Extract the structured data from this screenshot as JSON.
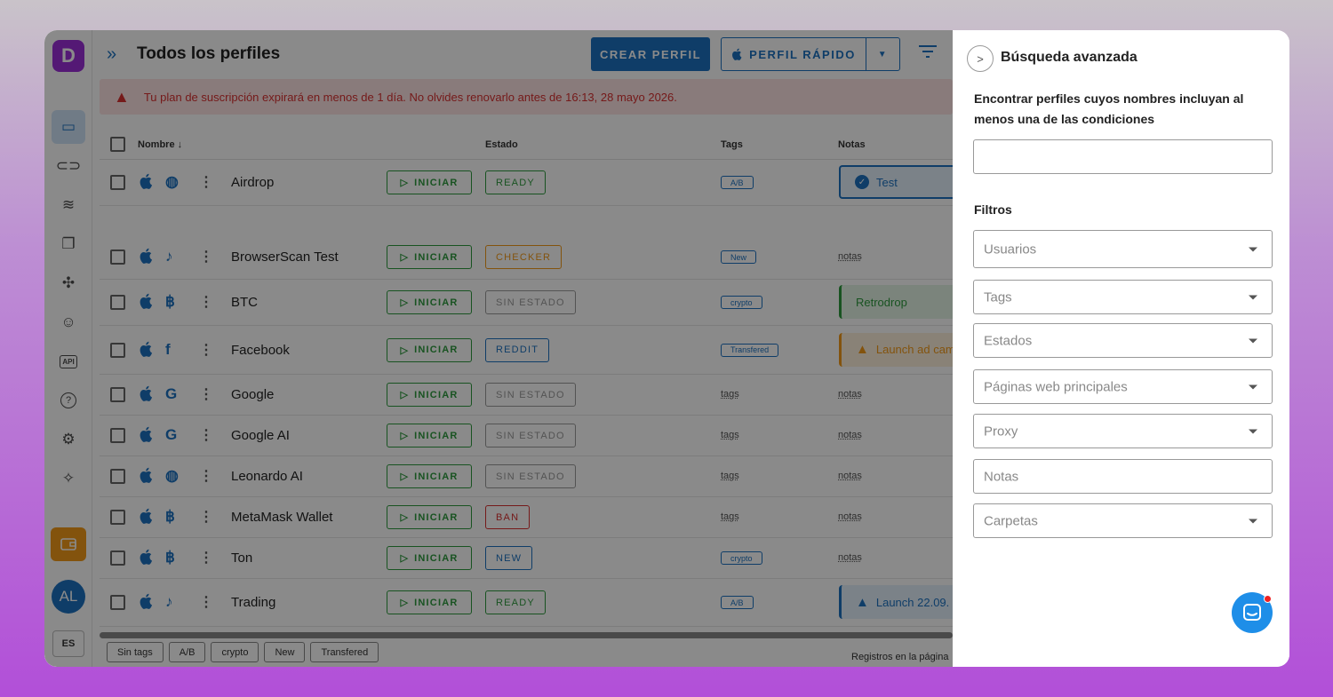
{
  "sidebar": {
    "logo": "D",
    "avatar": "AL",
    "lang": "ES",
    "icons": [
      "browser-icon",
      "link-icon",
      "automation-icon",
      "copy-icon",
      "extension-icon",
      "users-icon",
      "api-icon",
      "help-icon",
      "settings-icon",
      "bulb-icon"
    ],
    "api_label": "API"
  },
  "header": {
    "title": "Todos los perfiles",
    "create_button": "CREAR PERFIL",
    "quick_button": "PERFIL RÁPIDO"
  },
  "alert": {
    "text": "Tu plan de suscripción expirará en menos de 1 día. No olvides renovarlo antes de 16:13, 28 mayo 2026."
  },
  "table": {
    "columns": {
      "name": "Nombre",
      "status": "Estado",
      "tags": "Tags",
      "notes": "Notas"
    },
    "start_label": "INICIAR",
    "placeholder_tags": "tags",
    "placeholder_notes": "notas",
    "rows": [
      {
        "name": "Airdrop",
        "icon": "globe-icon",
        "status": "READY",
        "status_color": "#2e9a3e",
        "tag": "A/B",
        "note": "Test",
        "note_kind": "check",
        "note_bg": "#e3f0fc",
        "note_color": "#1c72c0"
      },
      {
        "name": "BrowserScan Test",
        "icon": "tiktok-icon",
        "status": "CHECKER",
        "status_color": "#f29a18",
        "tag": "New",
        "note": ""
      },
      {
        "name": "BTC",
        "icon": "bitcoin-icon",
        "status": "SIN ESTADO",
        "status_color": "#999999",
        "tag": "crypto",
        "note": "Retrodrop",
        "note_kind": "plain",
        "note_bg": "#e4f4e6",
        "note_color": "#2e9a3e"
      },
      {
        "name": "Facebook",
        "icon": "facebook-icon",
        "status": "REDDIT",
        "status_color": "#1c72c0",
        "tag": "Transfered",
        "note": "Launch ad cam",
        "note_kind": "warn",
        "note_bg": "#fdf0dc",
        "note_color": "#f29a18"
      },
      {
        "name": "Google",
        "icon": "google-icon",
        "status": "SIN ESTADO",
        "status_color": "#999999",
        "tag": "",
        "note": ""
      },
      {
        "name": "Google AI",
        "icon": "google-icon",
        "status": "SIN ESTADO",
        "status_color": "#999999",
        "tag": "",
        "note": ""
      },
      {
        "name": "Leonardo AI",
        "icon": "globe-icon",
        "status": "SIN ESTADO",
        "status_color": "#999999",
        "tag": "",
        "note": ""
      },
      {
        "name": "MetaMask Wallet",
        "icon": "bitcoin-icon",
        "status": "BAN",
        "status_color": "#d83030",
        "tag": "",
        "note": ""
      },
      {
        "name": "Ton",
        "icon": "bitcoin-icon",
        "status": "NEW",
        "status_color": "#1c72c0",
        "tag": "crypto",
        "note": ""
      },
      {
        "name": "Trading",
        "icon": "tiktok-icon",
        "status": "READY",
        "status_color": "#2e9a3e",
        "tag": "A/B",
        "note": "Launch 22.09.",
        "note_kind": "warn",
        "note_bg": "#e3f0fc",
        "note_color": "#1c72c0"
      }
    ]
  },
  "footer": {
    "chips": [
      "Sin tags",
      "A/B",
      "crypto",
      "New",
      "Transfered"
    ],
    "records_text": "Registros en la página"
  },
  "panel": {
    "title": "Búsqueda avanzada",
    "description": "Encontrar perfiles cuyos nombres incluyan al menos una de las condiciones",
    "search_value": "",
    "filters_label": "Filtros",
    "filters": [
      {
        "label": "Usuarios",
        "dropdown": true
      },
      {
        "label": "Tags",
        "dropdown": true
      },
      {
        "label": "Estados",
        "dropdown": true
      },
      {
        "label": "Páginas web principales",
        "dropdown": true
      },
      {
        "label": "Proxy",
        "dropdown": true
      },
      {
        "label": "Notas",
        "dropdown": false
      },
      {
        "label": "Carpetas",
        "dropdown": true
      }
    ]
  }
}
